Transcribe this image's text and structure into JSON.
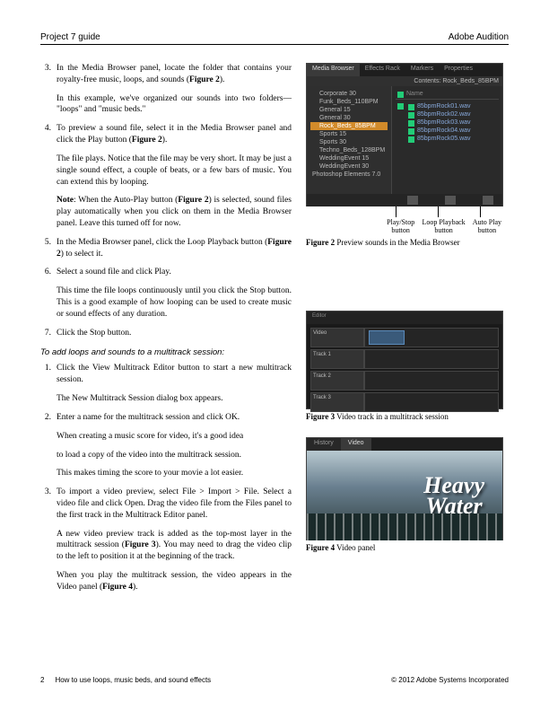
{
  "header": {
    "left": "Project 7 guide",
    "right": "Adobe Audition"
  },
  "steps1": [
    {
      "num": "3.",
      "paras": [
        "In the Media Browser panel, locate the folder that contains your royalty-free music, loops, and sounds (<b>Figure 2</b>).",
        "In this example, we've organized our sounds into two folders— \"loops\" and \"music beds.\""
      ]
    },
    {
      "num": "4.",
      "paras": [
        "To preview a sound file, select it in the Media Browser panel and click the Play button (<b>Figure 2</b>).",
        "The file plays. Notice that the file may be very short. It may be just a single sound effect, a couple of beats, or a few bars of music. You can extend this by looping.",
        "<b>Note</b>: When the Auto-Play button (<b>Figure 2</b>) is selected, sound files play automatically when you click on them in the Media Browser panel. Leave this turned off for now."
      ]
    },
    {
      "num": "5.",
      "paras": [
        "In the Media Browser panel, click the Loop Playback button (<b>Figure 2</b>) to select it."
      ]
    },
    {
      "num": "6.",
      "paras": [
        "Select a sound file and click Play.",
        "This time the file loops continuously until you click the Stop button. This is a good example of how looping can be used to create music or sound effects of any duration."
      ]
    },
    {
      "num": "7.",
      "paras": [
        "Click the Stop button."
      ]
    }
  ],
  "subhead": "To add loops and sounds to a multitrack session:",
  "steps2": [
    {
      "num": "1.",
      "paras": [
        "Click the View Multitrack Editor button to start a new multitrack session.",
        "The New Multitrack Session dialog box appears."
      ]
    },
    {
      "num": "2.",
      "paras": [
        "Enter a name for the multitrack session and click OK.",
        "When creating a music score for video, it's a good idea",
        "to load a copy of the video into the multitrack session.",
        "This makes timing the score to your movie a lot easier."
      ]
    },
    {
      "num": "3.",
      "paras": [
        "To import a video preview, select File > Import > File. Select a video file and click Open. Drag the video file from the Files panel to the first track in the Multitrack Editor panel.",
        "A new video preview track is added as the top-most layer in the multitrack session (<b>Figure 3</b>). You may need to drag the video clip to the left to position it at the beginning of the track.",
        "When you play the multitrack session, the video appears in the Video panel (<b>Figure 4</b>)."
      ]
    }
  ],
  "fig2": {
    "tabs": [
      "Media Browser",
      "Effects Rack",
      "Markers",
      "Properties"
    ],
    "contents_label": "Contents:",
    "contents_value": "Rock_Beds_85BPM",
    "name_col": "Name",
    "tree": [
      "Corporate 30",
      "Funk_Beds_110BPM",
      "General 15",
      "General 30",
      "Rock_Beds_85BPM",
      "Sports 15",
      "Sports 30",
      "Techno_Beds_128BPM",
      "WeddingEvent 15",
      "WeddingEvent 30"
    ],
    "tree_extra": "Photoshop Elements 7.0",
    "files": [
      "85bpmRock01.wav",
      "85bpmRock02.wav",
      "85bpmRock03.wav",
      "85bpmRock04.wav",
      "85bpmRock05.wav"
    ],
    "labels": {
      "play": "Play/Stop button",
      "loop": "Loop Playback button",
      "auto": "Auto Play button"
    },
    "caption_bold": "Figure 2",
    "caption_rest": " Preview sounds in the Media Browser"
  },
  "fig3": {
    "caption_bold": "Figure 3",
    "caption_rest": " Video track in a multitrack session"
  },
  "fig4": {
    "tab_history": "History",
    "tab_video": "Video",
    "title1": "Heavy",
    "title2": "Water",
    "caption_bold": "Figure 4",
    "caption_rest": " Video panel"
  },
  "footer": {
    "page": "2",
    "title": "How to use loops, music beds, and sound effects",
    "copyright": "© 2012 Adobe Systems Incorporated"
  }
}
